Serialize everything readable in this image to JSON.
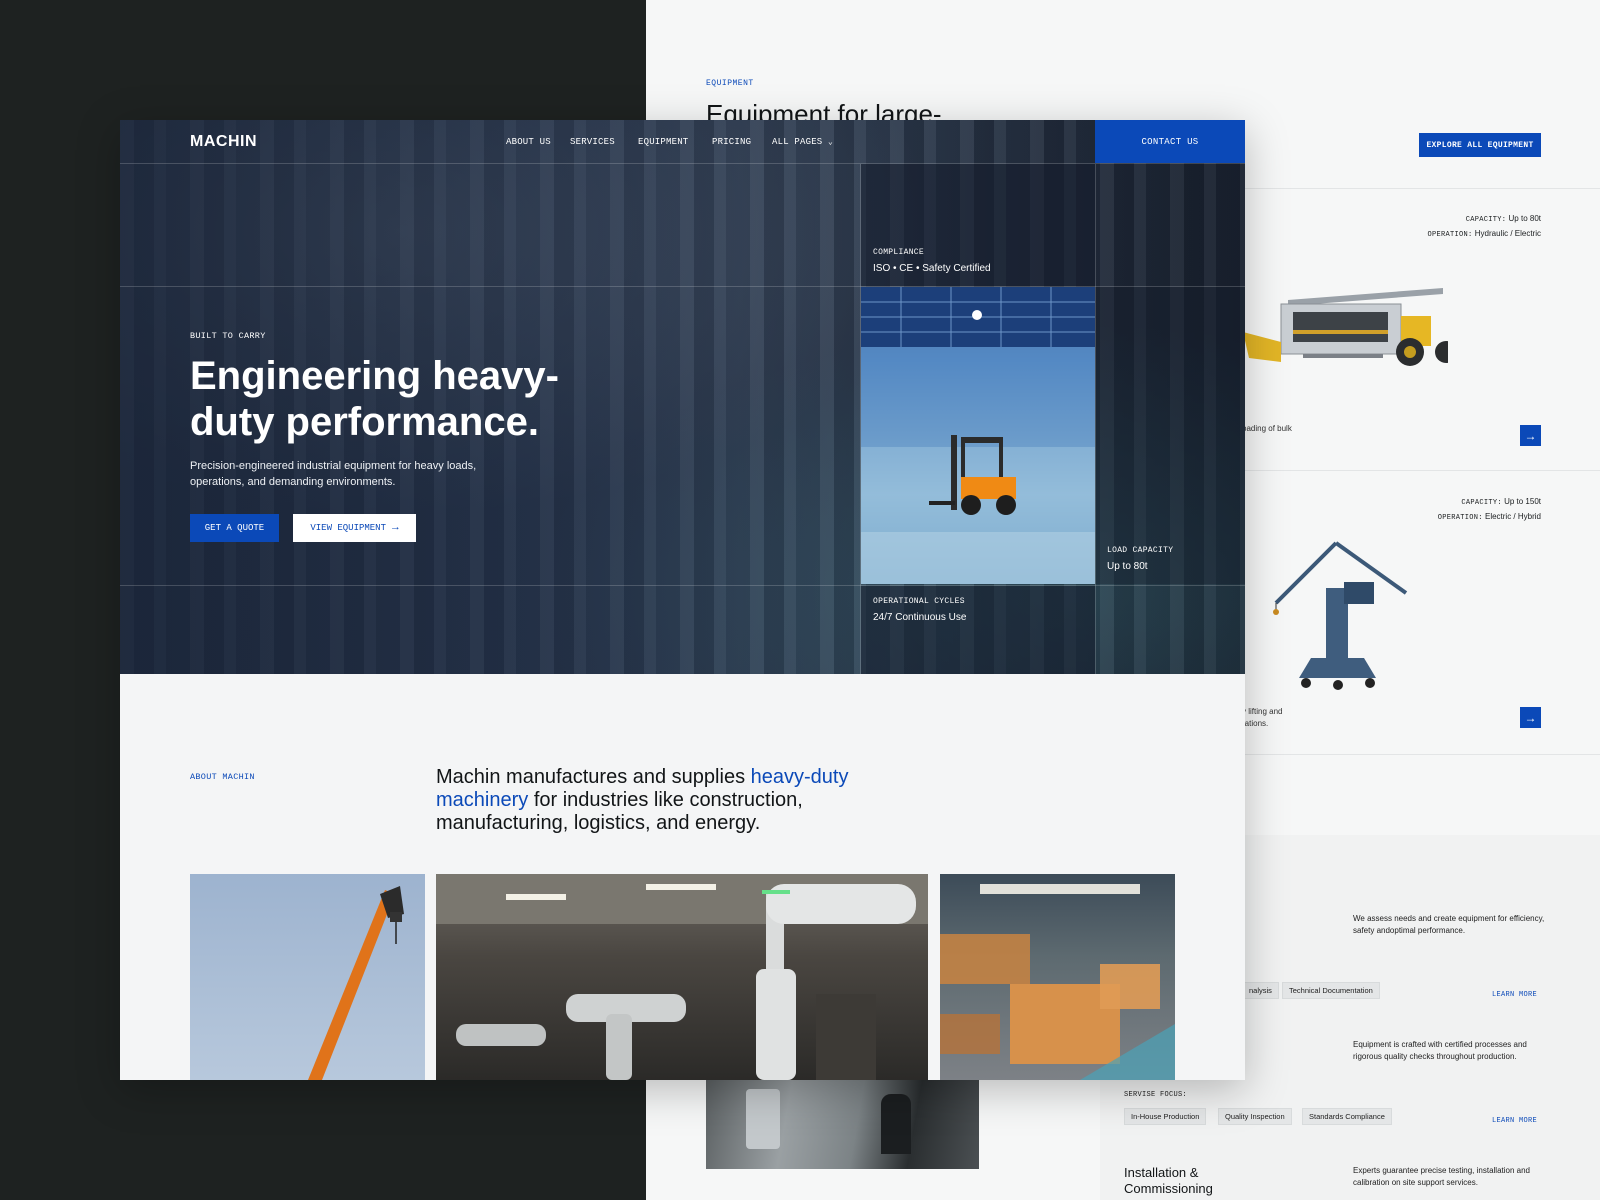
{
  "back_page": {
    "section_label": "EQUIPMENT",
    "section_title": "Equipment for large-",
    "explore_button": "EXPLORE ALL EQUIPMENT",
    "cards": [
      {
        "capacity_label": "CAPACITY:",
        "capacity_value": "Up to 80t",
        "operation_label": "OPERATION:",
        "operation_value": "Hydraulic / Electric",
        "desc": "oading of bulk"
      },
      {
        "capacity_label": "CAPACITY:",
        "capacity_value": "Up to 150t",
        "operation_label": "OPERATION:",
        "operation_value": "Electric / Hybrid",
        "desc_line1": "y lifting and",
        "desc_line2": "rations."
      }
    ],
    "services": {
      "item1_text": "We assess needs and create equipment for efficiency, safety andoptimal performance.",
      "item1_tags": [
        "nalysis",
        "Technical Documentation"
      ],
      "item2_text": "Equipment is crafted with certified processes and rigorous quality checks throughout production.",
      "focus_label": "SERVISE FOCUS:",
      "item2_tags": [
        "In-House Production",
        "Quality Inspection",
        "Standards Compliance"
      ],
      "learn_more": "LEARN MORE",
      "item3_title": "Installation & Commissioning",
      "item3_text": "Experts guarantee precise testing, installation and calibration on site support services."
    }
  },
  "front_page": {
    "logo": "MACHIN",
    "nav": [
      "ABOUT US",
      "SERVICES",
      "EQUIPMENT",
      "PRICING",
      "ALL PAGES"
    ],
    "contact_button": "CONTACT US",
    "stats": {
      "compliance_label": "COMPLIANCE",
      "compliance_value": "ISO • CE • Safety Certified",
      "load_label": "LOAD CAPACITY",
      "load_value": "Up to 80t",
      "cycles_label": "OPERATIONAL CYCLES",
      "cycles_value": "24/7 Continuous Use"
    },
    "hero": {
      "eyebrow": "BUILT TO CARRY",
      "headline": "Engineering heavy-duty performance.",
      "subtext": "Precision-engineered industrial equipment for heavy loads, operations, and demanding environments.",
      "quote_button": "GET A QUOTE",
      "view_button": "VIEW EQUIPMENT"
    },
    "about": {
      "label": "ABOUT MACHIN",
      "text_before": "Machin manufactures and supplies ",
      "text_highlight": "heavy-duty machinery",
      "text_after": " for industries like construction, manufacturing, logistics, and energy."
    }
  },
  "colors": {
    "accent": "#0b49b8",
    "dark_bg": "#1e2221",
    "light_bg": "#f6f7f7"
  }
}
